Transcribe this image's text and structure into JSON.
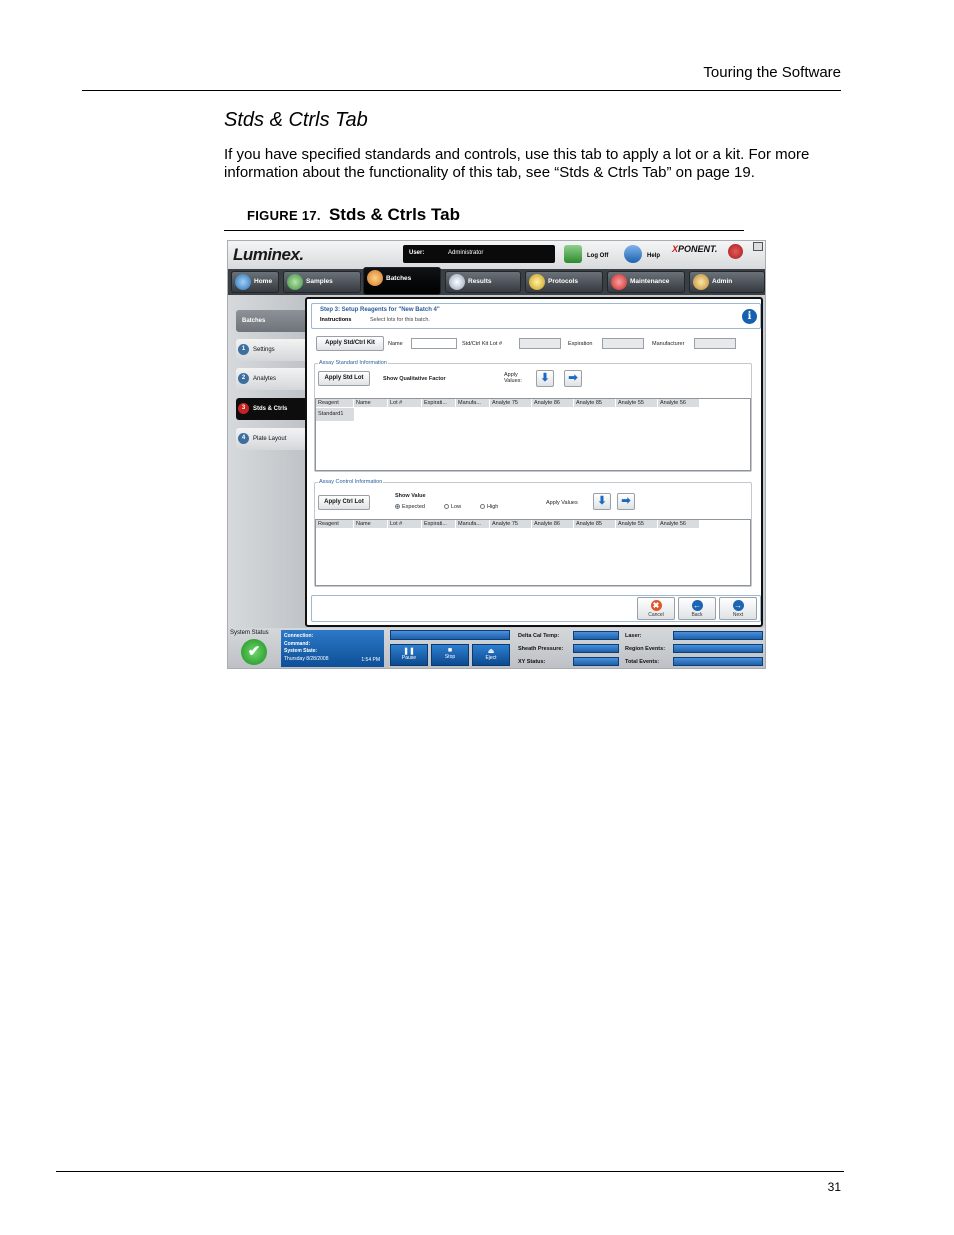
{
  "header": {
    "text": "Touring the Software"
  },
  "section": {
    "title": "Stds & Ctrls Tab",
    "paragraph": "If you have specified standards and controls, use this tab to apply a lot or a kit. For more information about the functionality of this tab, see “Stds & Ctrls Tab” on page 19."
  },
  "figure": {
    "label": "FIGURE 17.",
    "title": "Stds & Ctrls Tab"
  },
  "page_number": "31",
  "app": {
    "logo": "Luminex.",
    "user_label": "User:",
    "user_value": "Administrator",
    "log_off": "Log Off",
    "help": "Help",
    "brand": {
      "prefix": "X",
      "rest": "PONENT."
    },
    "tabs": [
      "Home",
      "Samples",
      "Batches",
      "Results",
      "Protocols",
      "Maintenance",
      "Admin"
    ],
    "sidebar": {
      "header": "Batches",
      "items": [
        {
          "num": "1",
          "label": "Settings"
        },
        {
          "num": "2",
          "label": "Analytes"
        },
        {
          "num": "3",
          "label": "Stds & Ctrls"
        },
        {
          "num": "4",
          "label": "Plate Layout"
        }
      ]
    },
    "step": {
      "title": "Step 3: Setup Reagents for \"New Batch 4\"",
      "instructions_label": "Instructions",
      "instructions": "Select lots for this batch."
    },
    "kit_row": {
      "apply_kit": "Apply Std/Ctrl Kit",
      "name_label": "Name",
      "kit_lot_label": "Std/Ctrl Kit Lot #",
      "expiration_label": "Expiration",
      "manufacturer_label": "Manufacturer"
    },
    "standard_group": {
      "title": "Assay Standard Information",
      "apply_lot": "Apply Std Lot",
      "show_factor": "Show Qualitative Factor",
      "apply_values": "Apply Values:",
      "columns": [
        "Reagent",
        "Name",
        "Lot #",
        "Expirati...",
        "Manufa...",
        "Analyte 75",
        "Analyte 86",
        "Analyte 85",
        "Analyte 55",
        "Analyte 56"
      ],
      "rows": [
        "Standard1"
      ]
    },
    "control_group": {
      "title": "Assay Control Information",
      "apply_lot": "Apply Ctrl Lot",
      "show_value": "Show Value",
      "radios": [
        {
          "label": "Expected",
          "selected": true
        },
        {
          "label": "Low",
          "selected": false
        },
        {
          "label": "High",
          "selected": false
        }
      ],
      "apply_values": "Apply Values",
      "columns": [
        "Reagent",
        "Name",
        "Lot #",
        "Expirati...",
        "Manufa...",
        "Analyte 75",
        "Analyte 86",
        "Analyte 85",
        "Analyte 55",
        "Analyte 56"
      ]
    },
    "nav_buttons": {
      "cancel": "Cancel",
      "back": "Back",
      "next": "Next"
    },
    "status": {
      "label": "System Status",
      "connection": "Connection:",
      "command": "Command:",
      "system_state": "System State:",
      "date": "Thursday 8/28/2008",
      "time": "1:54 PM",
      "pause": "Pause",
      "stop": "Stop",
      "eject": "Eject",
      "delta_cal": "Delta Cal Temp:",
      "sheath": "Sheath Pressure:",
      "xy": "XY Status:",
      "laser": "Laser:",
      "region": "Region Events:",
      "total": "Total Events:"
    }
  }
}
